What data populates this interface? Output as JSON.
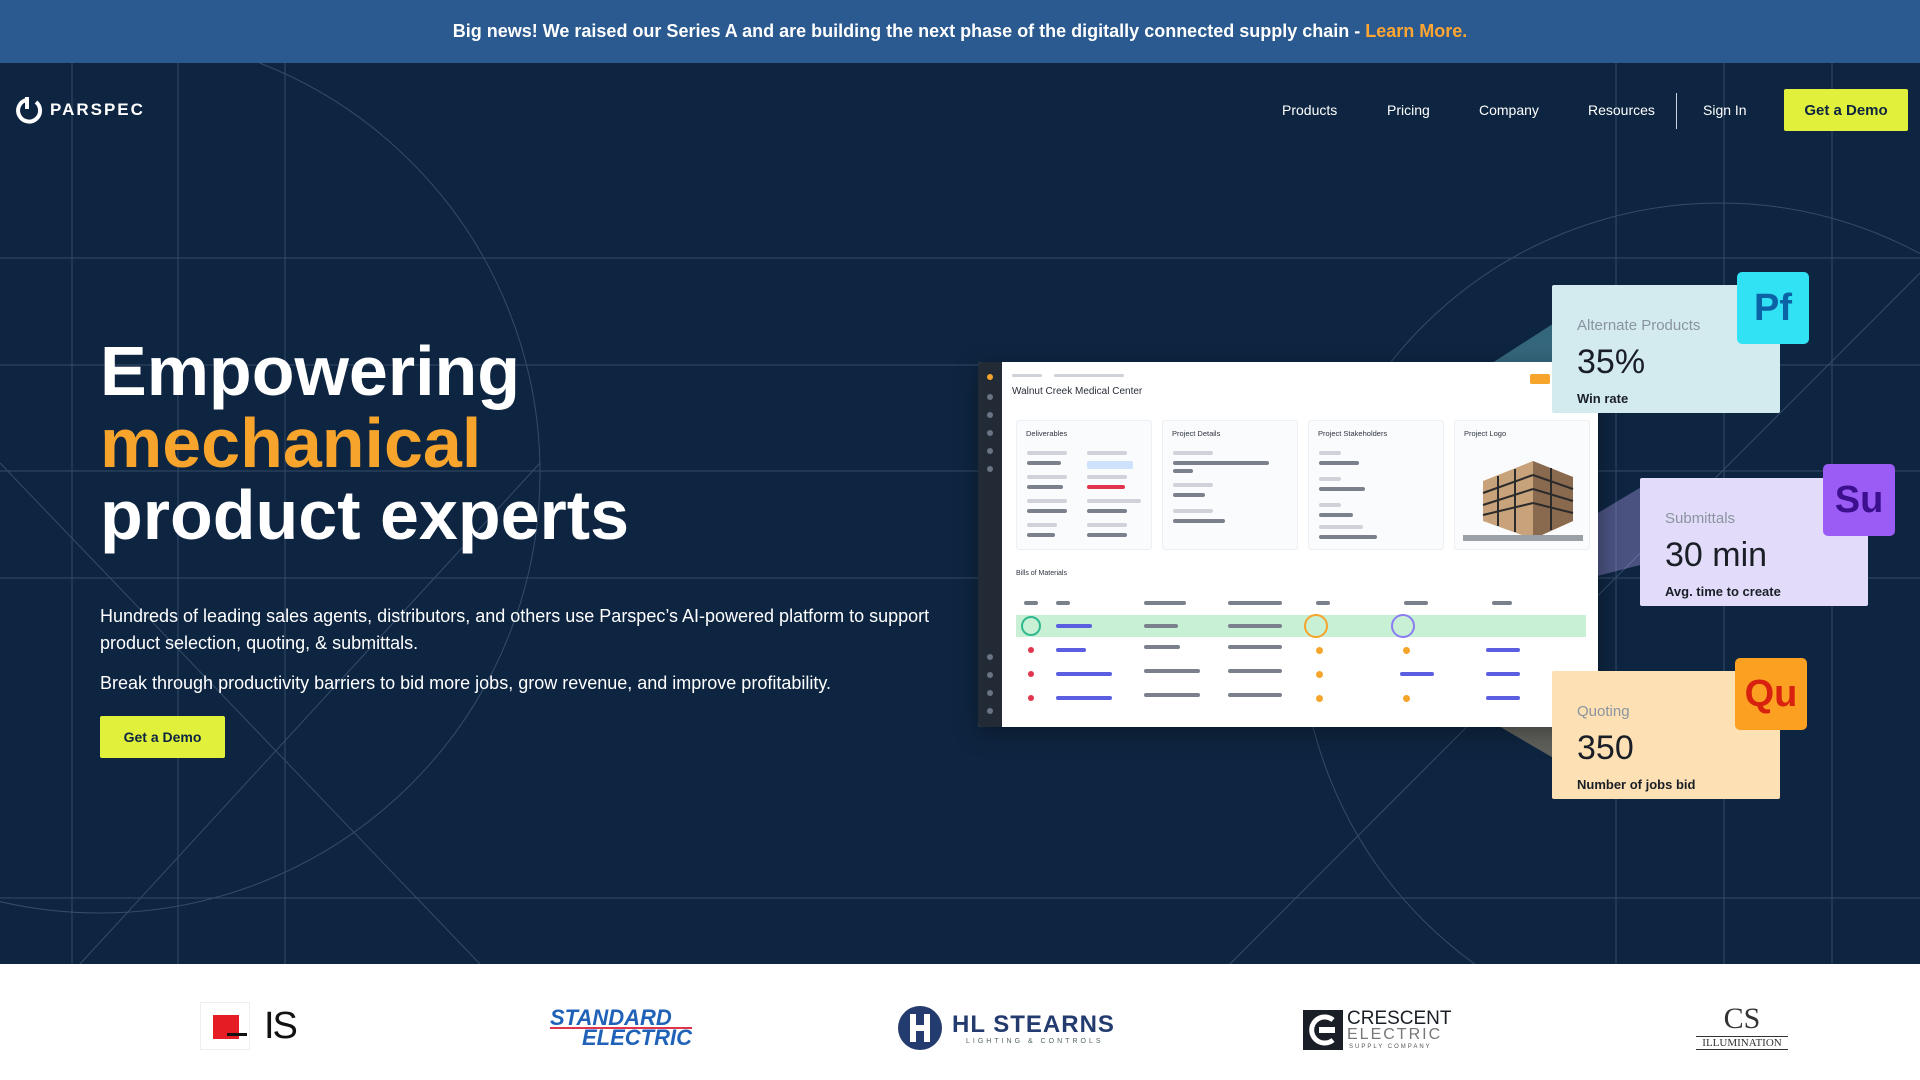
{
  "announcement": {
    "text": "Big news! We raised our Series A and are building the next phase of the digitally connected supply chain -",
    "link": "Learn More."
  },
  "nav": {
    "logo": "PARSPEC",
    "links": [
      "Products",
      "Pricing",
      "Company",
      "Resources"
    ],
    "sign_in": "Sign In",
    "demo": "Get a Demo"
  },
  "hero": {
    "headline_line1": "Empowering",
    "headline_accent": "mechanical",
    "headline_line3": "product experts",
    "sub1": "Hundreds of leading sales agents, distributors, and others use Parspec’s AI-powered platform to support product selection, quoting, & submittals.",
    "sub2": "Break through productivity barriers to bid more jobs, grow revenue, and improve profitability.",
    "cta": "Get a Demo"
  },
  "dashboard": {
    "project_title": "Walnut Creek Medical Center",
    "cards": [
      "Deliverables",
      "Project Details",
      "Project Stakeholders",
      "Project Logo"
    ],
    "bom_label": "Bills of Materials"
  },
  "stats": [
    {
      "label": "Alternate Products",
      "value": "35%",
      "desc": "Win rate",
      "badge": "Pf",
      "bg": "#d3ebee",
      "badge_bg": "#31e2f4",
      "badge_fg": "#0b63a6"
    },
    {
      "label": "Submittals",
      "value": "30 min",
      "desc": "Avg. time to create",
      "badge": "Su",
      "bg": "#e2dcfa",
      "badge_bg": "#9b5cf6",
      "badge_fg": "#3b0f8d"
    },
    {
      "label": "Quoting",
      "value": "350",
      "desc": "Number of jobs bid",
      "badge": "Qu",
      "bg": "#fde1b4",
      "badge_bg": "#fca022",
      "badge_fg": "#d8210f"
    }
  ],
  "customers": {
    "ies_text": "IS",
    "standard_line1": "STANDARD",
    "standard_line2": "ELECTRIC",
    "hl_name": "HL STEARNS",
    "hl_sub": "LIGHTING & CONTROLS",
    "crescent_line1": "CRESCENT",
    "crescent_line2": "ELECTRIC",
    "crescent_line3": "SUPPLY COMPANY",
    "cs_line1": "CS",
    "cs_line2": "ILLUMINATION"
  },
  "colors": {
    "hero_bg": "#0e2541",
    "announcement_bg": "#2a5a8f",
    "accent_orange": "#f6a42c",
    "cta_yellow": "#e1f03a"
  }
}
